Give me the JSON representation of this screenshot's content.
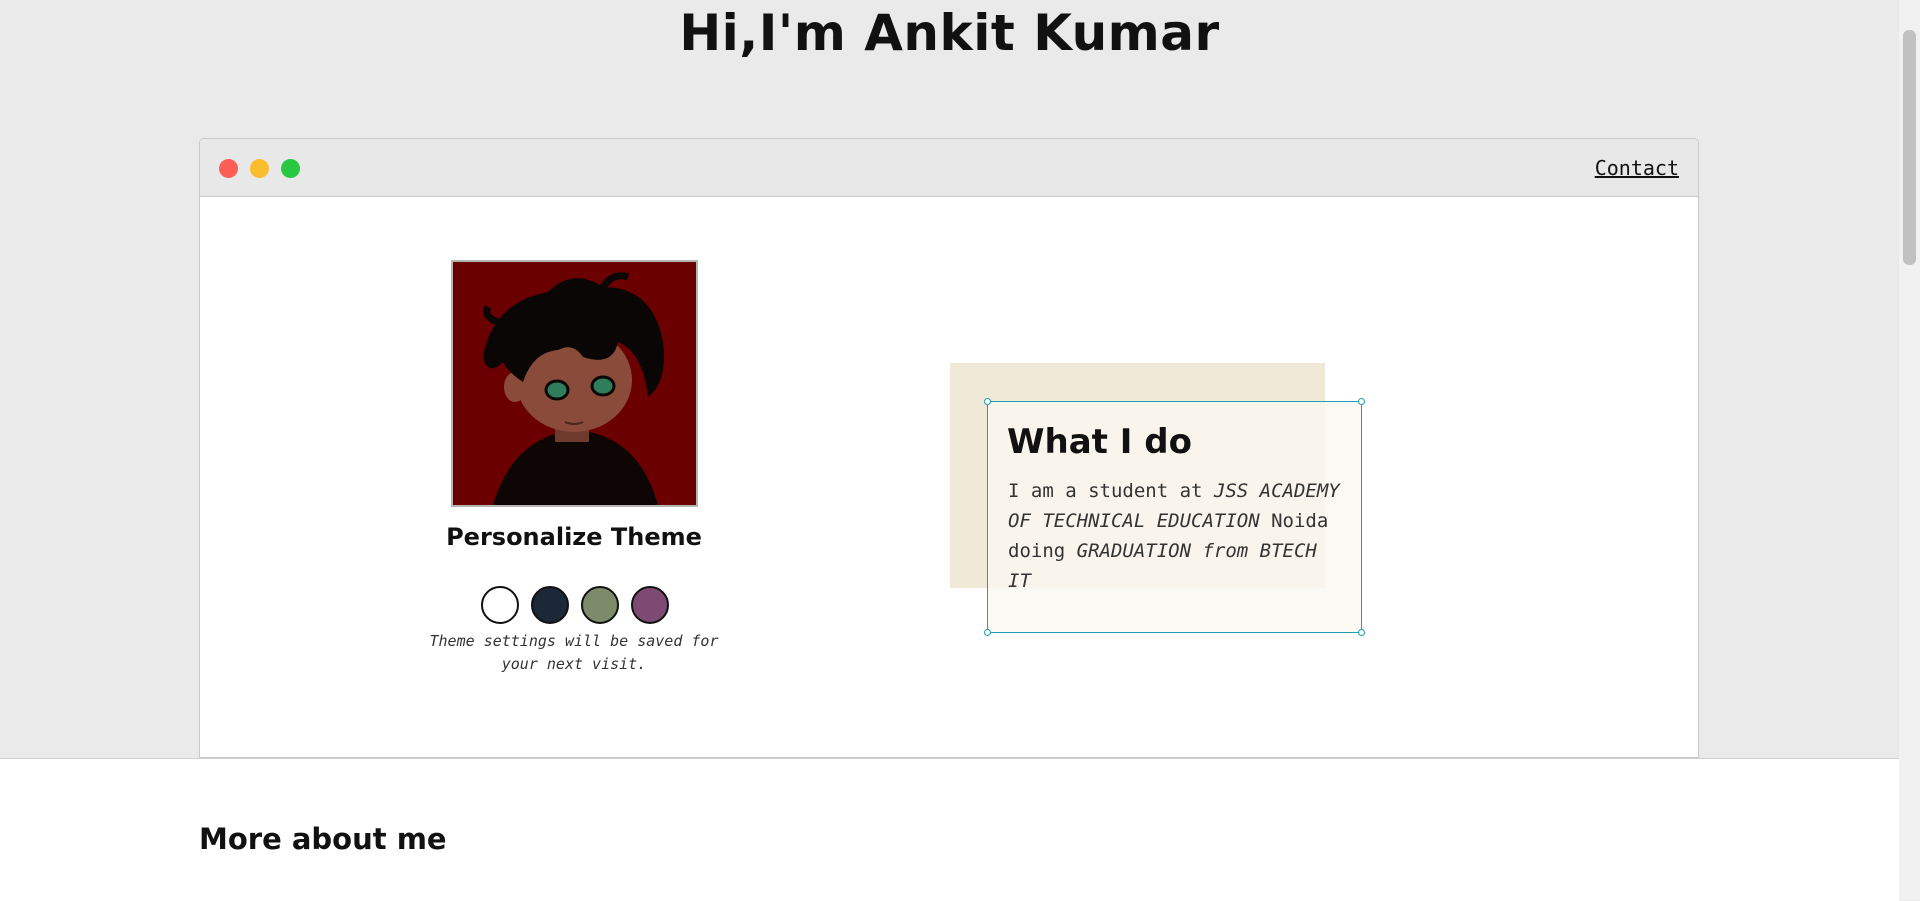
{
  "header": {
    "title": "Hi,I'm Ankit Kumar"
  },
  "window": {
    "controls": [
      "close",
      "minimize",
      "maximize"
    ],
    "nav": {
      "contact_label": "Contact"
    }
  },
  "profile": {
    "avatar": "cartoon-avatar",
    "theme_title": "Personalize Theme",
    "theme_swatches": [
      {
        "name": "light",
        "color": "#ffffff"
      },
      {
        "name": "dark",
        "color": "#1b2838"
      },
      {
        "name": "sage",
        "color": "#7c8b6a"
      },
      {
        "name": "plum",
        "color": "#7d4a73"
      }
    ],
    "theme_note": "Theme settings will be saved for your next visit."
  },
  "about_card": {
    "title": "What I do",
    "text_parts": [
      {
        "text": "I am a student at ",
        "italic": false
      },
      {
        "text": "JSS ACADEMY OF TECHNICAL EDUCATION",
        "italic": true
      },
      {
        "text": " Noida doing ",
        "italic": false
      },
      {
        "text": "GRADUATION from BTECH IT",
        "italic": true
      }
    ]
  },
  "more_section": {
    "title": "More about me"
  }
}
